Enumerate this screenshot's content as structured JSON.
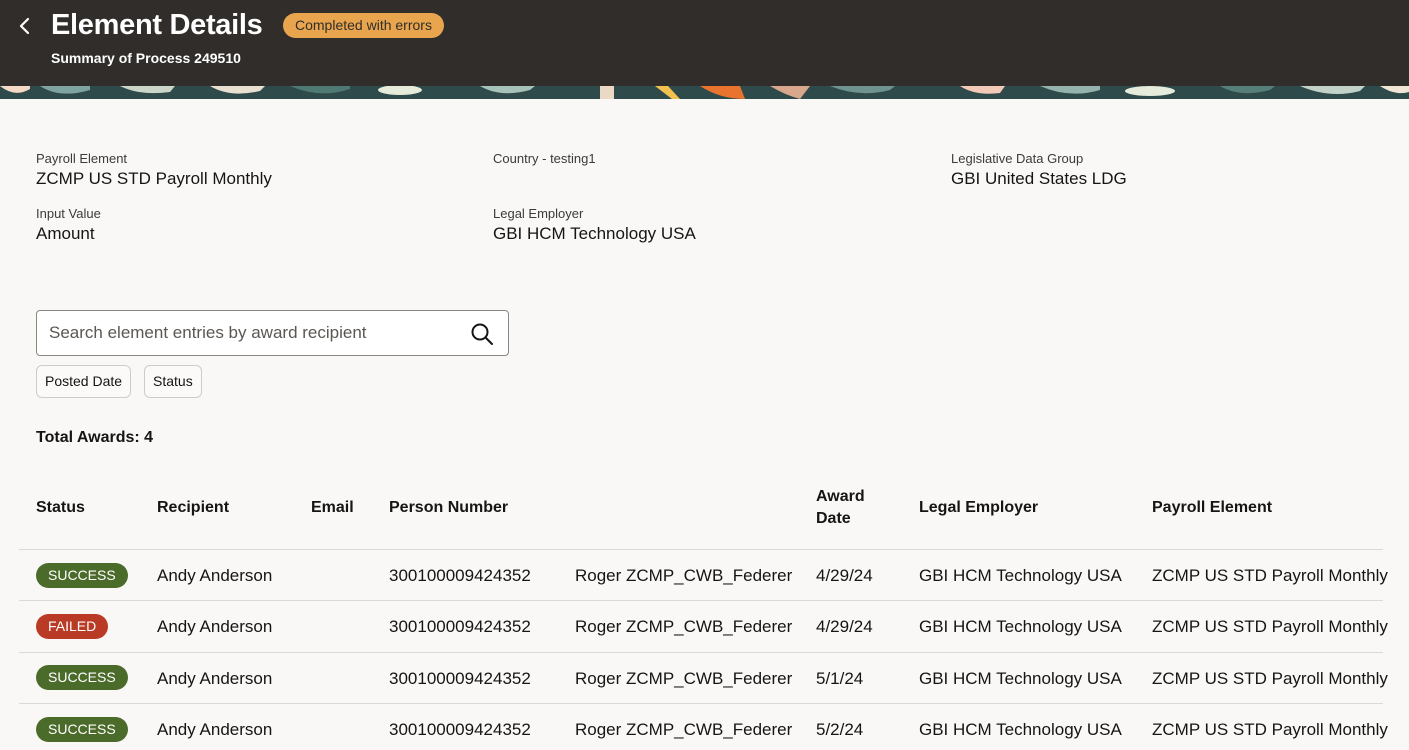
{
  "header": {
    "title": "Element Details",
    "status": "Completed with errors",
    "subtitle": "Summary of Process 249510"
  },
  "summary": {
    "payroll_element": {
      "label": "Payroll Element",
      "value": "ZCMP US STD Payroll Monthly"
    },
    "country": {
      "label": "Country - testing1",
      "value": ""
    },
    "ldg": {
      "label": "Legislative Data Group",
      "value": "GBI United States LDG"
    },
    "input_value": {
      "label": "Input Value",
      "value": "Amount"
    },
    "legal_employer": {
      "label": "Legal Employer",
      "value": "GBI HCM Technology USA"
    }
  },
  "search": {
    "placeholder": "Search element entries by award recipient"
  },
  "filters": [
    {
      "label": "Posted Date"
    },
    {
      "label": "Status"
    }
  ],
  "total_awards": "Total Awards: 4",
  "table": {
    "headers": {
      "status": "Status",
      "recipient": "Recipient",
      "email": "Email",
      "person_number": "Person Number",
      "award_date_1": "Award",
      "award_date_2": "Date",
      "legal_employer": "Legal Employer",
      "payroll_element": "Payroll Element"
    },
    "rows": [
      {
        "status": "SUCCESS",
        "recipient": "Andy Anderson",
        "person_number": "300100009424352",
        "manager": "Roger ZCMP_CWB_Federer",
        "award_date": "4/29/24",
        "legal_employer": "GBI HCM Technology USA",
        "payroll_element": "ZCMP US STD Payroll Monthly"
      },
      {
        "status": "FAILED",
        "recipient": "Andy Anderson",
        "person_number": "300100009424352",
        "manager": "Roger ZCMP_CWB_Federer",
        "award_date": "4/29/24",
        "legal_employer": "GBI HCM Technology USA",
        "payroll_element": "ZCMP US STD Payroll Monthly"
      },
      {
        "status": "SUCCESS",
        "recipient": "Andy Anderson",
        "person_number": "300100009424352",
        "manager": "Roger ZCMP_CWB_Federer",
        "award_date": "5/1/24",
        "legal_employer": "GBI HCM Technology USA",
        "payroll_element": "ZCMP US STD Payroll Monthly"
      },
      {
        "status": "SUCCESS",
        "recipient": "Andy Anderson",
        "person_number": "300100009424352",
        "manager": "Roger ZCMP_CWB_Federer",
        "award_date": "5/2/24",
        "legal_employer": "GBI HCM Technology USA",
        "payroll_element": "ZCMP US STD Payroll Monthly"
      }
    ]
  },
  "colors": {
    "header_bg": "#312d2a",
    "status_pill": "#e8a54d",
    "success": "#4b6b2a",
    "failed": "#b93a25"
  }
}
